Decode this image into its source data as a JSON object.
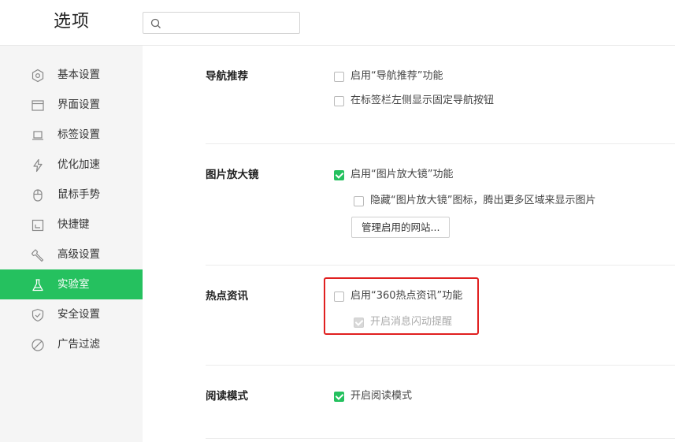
{
  "header": {
    "title": "选项",
    "search": {
      "placeholder": "",
      "value": ""
    }
  },
  "sidebar": {
    "items": [
      {
        "label": "基本设置",
        "icon": "hexagon-icon",
        "active": false
      },
      {
        "label": "界面设置",
        "icon": "window-icon",
        "active": false
      },
      {
        "label": "标签设置",
        "icon": "laptop-icon",
        "active": false
      },
      {
        "label": "优化加速",
        "icon": "lightning-icon",
        "active": false
      },
      {
        "label": "鼠标手势",
        "icon": "mouse-icon",
        "active": false
      },
      {
        "label": "快捷键",
        "icon": "shortcut-icon",
        "active": false
      },
      {
        "label": "高级设置",
        "icon": "wrench-icon",
        "active": false
      },
      {
        "label": "实验室",
        "icon": "flask-icon",
        "active": true
      },
      {
        "label": "安全设置",
        "icon": "shield-icon",
        "active": false
      },
      {
        "label": "广告过滤",
        "icon": "ban-icon",
        "active": false
      }
    ]
  },
  "sections": {
    "nav": {
      "title": "导航推荐",
      "opt1": {
        "label": "启用“导航推荐”功能",
        "checked": false
      },
      "opt2": {
        "label": "在标签栏左侧显示固定导航按钮",
        "checked": false
      }
    },
    "magnifier": {
      "title": "图片放大镜",
      "opt1": {
        "label": "启用“图片放大镜”功能",
        "checked": true
      },
      "opt2": {
        "label": "隐藏“图片放大镜”图标，腾出更多区域来显示图片",
        "checked": false
      },
      "button": "管理启用的网站..."
    },
    "hotnews": {
      "title": "热点资讯",
      "opt1": {
        "label": "启用“360热点资讯”功能",
        "checked": false
      },
      "opt2": {
        "label": "开启消息闪动提醒",
        "checked": true,
        "disabled": true
      }
    },
    "reading": {
      "title": "阅读模式",
      "opt1": {
        "label": "开启阅读模式",
        "checked": true
      }
    }
  },
  "colors": {
    "accent": "#25c15f",
    "highlight": "#e02020",
    "sidebar_bg": "#f5f5f5"
  }
}
